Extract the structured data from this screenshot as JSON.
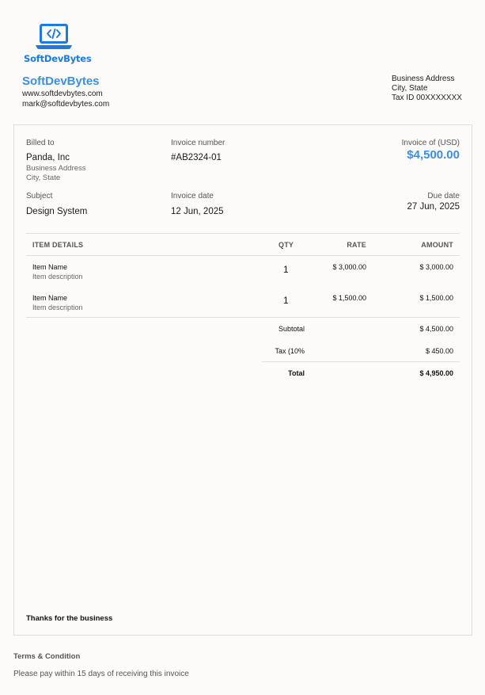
{
  "brand": {
    "logo_text": "SoftDevBytes",
    "name": "SoftDevBytes",
    "website": "www.softdevbytes.com",
    "email": "mark@softdevbytes.com",
    "color": "#1e7bd8"
  },
  "business": {
    "address": "Business Address",
    "city": "City, State",
    "tax_id": "Tax ID 00XXXXXXX"
  },
  "billed_to": {
    "label": "Billed to",
    "name": "Panda, Inc",
    "address": "Business Address",
    "city": "City, State"
  },
  "invoice_number": {
    "label": "Invoice number",
    "value": "#AB2324-01"
  },
  "invoice_total": {
    "label": "Invoice of (USD)",
    "value": "$4,500.00"
  },
  "subject": {
    "label": "Subject",
    "value": "Design System"
  },
  "invoice_date": {
    "label": "Invoice date",
    "value": "12 Jun, 2025"
  },
  "due_date": {
    "label": "Due date",
    "value": "27 Jun, 2025"
  },
  "table": {
    "headers": {
      "item": "ITEM DETAILS",
      "qty": "QTY",
      "rate": "RATE",
      "amount": "AMOUNT"
    },
    "rows": [
      {
        "name": "Item Name",
        "description": "Item description",
        "qty": "1",
        "rate": "$ 3,000.00",
        "amount": "$ 3,000.00"
      },
      {
        "name": "Item Name",
        "description": "Item description",
        "qty": "1",
        "rate": "$ 1,500.00",
        "amount": "$ 1,500.00"
      }
    ]
  },
  "summary": {
    "subtotal_label": "Subtotal",
    "subtotal_value": "$ 4,500.00",
    "tax_label": "Tax (10%",
    "tax_value": "$ 450.00",
    "total_label": "Total",
    "total_value": "$ 4,950.00"
  },
  "footer": {
    "thanks": "Thanks for the business",
    "terms_title": "Terms & Condition",
    "terms_body": "Please pay within 15 days of receiving this invoice"
  }
}
